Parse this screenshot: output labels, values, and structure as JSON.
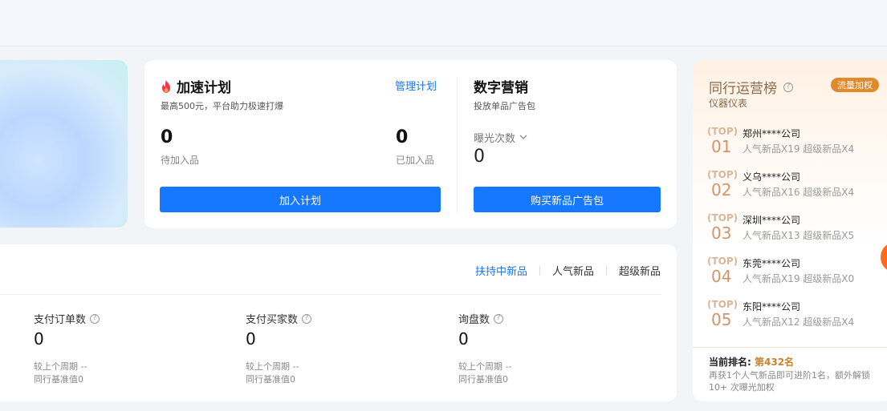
{
  "accelerate": {
    "title": "加速计划",
    "manage_link": "管理计划",
    "subtitle": "最高500元，平台助力极速打爆",
    "pending_value": "0",
    "pending_label": "待加入品",
    "joined_value": "0",
    "joined_label": "已加入品",
    "join_button": "加入计划"
  },
  "marketing": {
    "title": "数字营销",
    "subtitle": "投放单品广告包",
    "metric_select": "曝光次数",
    "metric_value": "0",
    "buy_button": "购买新品广告包"
  },
  "stats": {
    "tabs": [
      {
        "label": "扶持中新品",
        "active": true
      },
      {
        "label": "人气新品",
        "active": false
      },
      {
        "label": "超级新品",
        "active": false
      }
    ],
    "items": [
      {
        "label": "支付订单数",
        "value": "0",
        "compare": "较上个周期 --",
        "baseline": "同行基准值0"
      },
      {
        "label": "支付买家数",
        "value": "0",
        "compare": "较上个周期 --",
        "baseline": "同行基准值0"
      },
      {
        "label": "询盘数",
        "value": "0",
        "compare": "较上个周期 --",
        "baseline": "同行基准值0"
      }
    ]
  },
  "ranking": {
    "title": "同行运营榜",
    "subtitle": "仪器仪表",
    "badge": "流量加权",
    "top_tag": "TOP",
    "items": [
      {
        "rank": "01",
        "company": "郑州****公司",
        "desc": "人气新品X19 超级新品X4"
      },
      {
        "rank": "02",
        "company": "义乌****公司",
        "desc": "人气新品X16 超级新品X4"
      },
      {
        "rank": "03",
        "company": "深圳****公司",
        "desc": "人气新品X13 超级新品X5"
      },
      {
        "rank": "04",
        "company": "东莞****公司",
        "desc": "人气新品X19 超级新品X0"
      },
      {
        "rank": "05",
        "company": "东阳****公司",
        "desc": "人气新品X12 超级新品X4"
      }
    ],
    "current_label": "当前排名:",
    "current_rank": "第432名",
    "current_desc": "再获1个人气新品即可进阶1名，额外解锁 10+ 次曝光加权"
  },
  "colors": {
    "primary": "#1677ff",
    "rank_accent": "#e08a2c"
  }
}
